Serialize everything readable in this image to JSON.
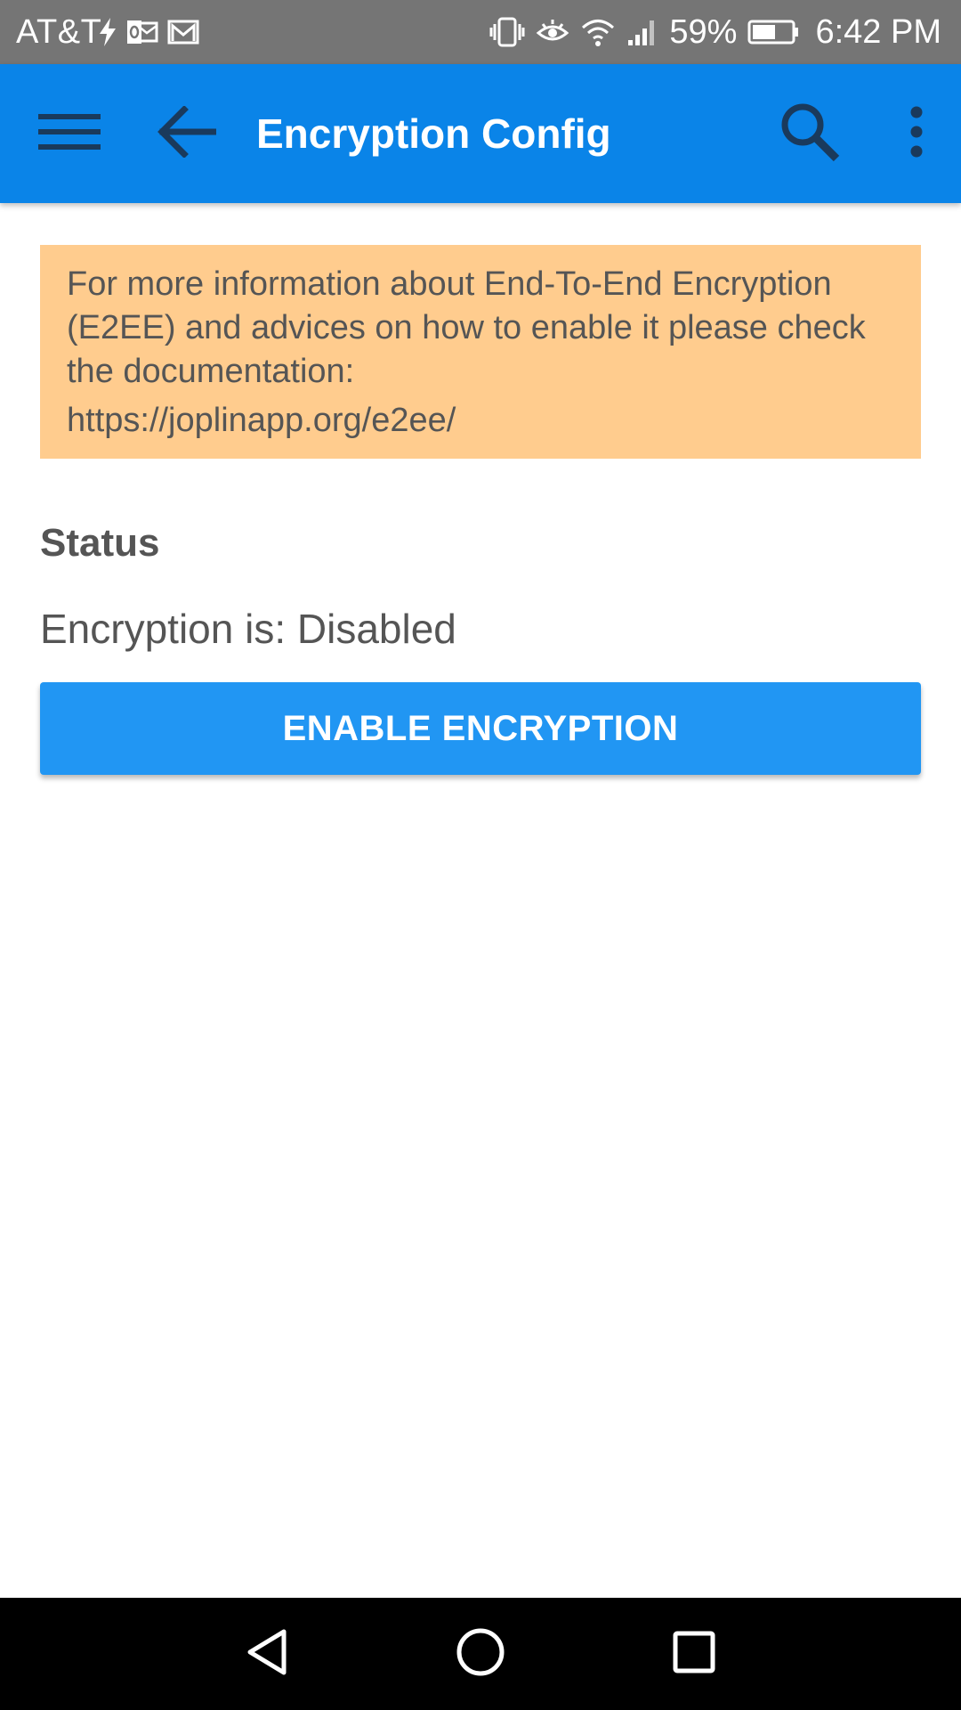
{
  "status_bar": {
    "carrier": "AT&T",
    "battery_percent": "59%",
    "time": "6:42 PM",
    "icons_left": [
      "lightning-icon",
      "outlook-icon",
      "gmail-icon"
    ],
    "icons_right": [
      "vibrate-icon",
      "eye-icon",
      "wifi-icon",
      "signal-icon",
      "battery-icon"
    ]
  },
  "app_bar": {
    "title": "Encryption Config",
    "background_color": "#0a84e8",
    "icons": [
      "menu-icon",
      "back-arrow-icon",
      "search-icon",
      "more-vert-icon"
    ]
  },
  "info_box": {
    "text": "For more information about End-To-End Encryption (E2EE) and advices on how to enable it please check the documentation:",
    "link": "https://joplinapp.org/e2ee/",
    "background_color": "#ffcc8e"
  },
  "status_section": {
    "heading": "Status",
    "status_text": "Encryption is: Disabled"
  },
  "enable_button": {
    "label": "ENABLE ENCRYPTION",
    "background_color": "#2196f3"
  },
  "nav_bar": {
    "icons": [
      "nav-back-icon",
      "nav-home-icon",
      "nav-recents-icon"
    ]
  }
}
